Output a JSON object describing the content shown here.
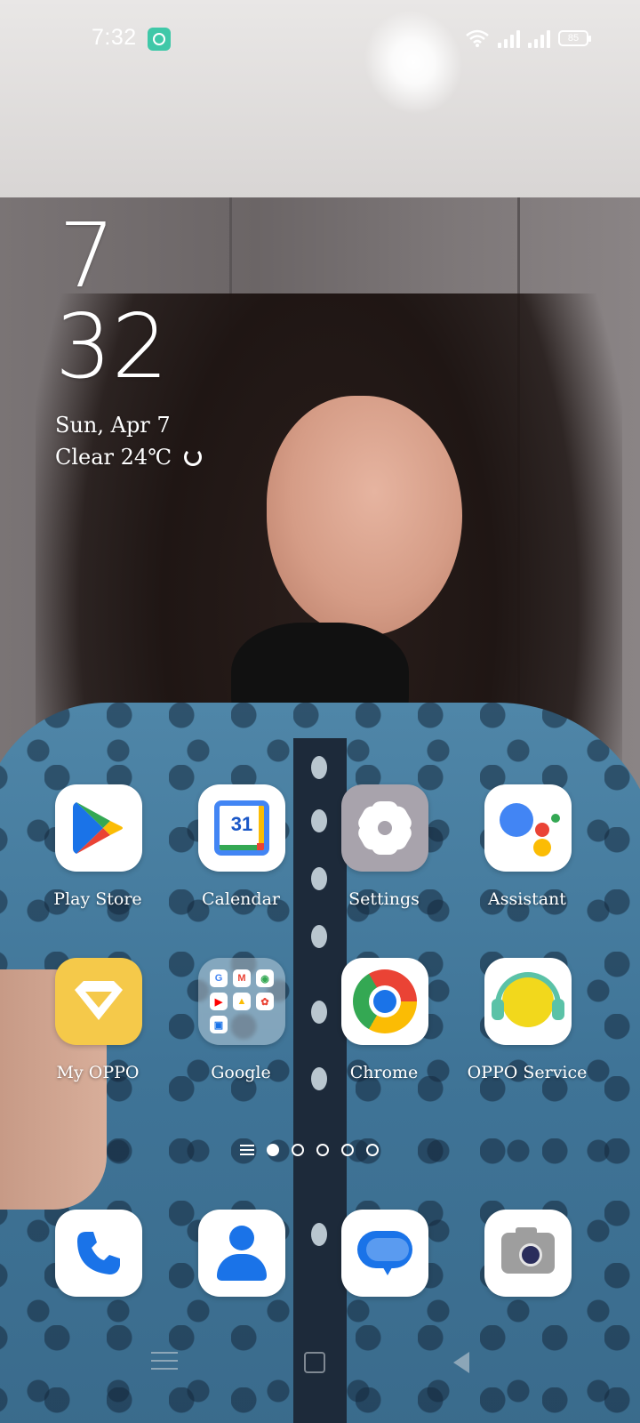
{
  "status_bar": {
    "time": "7:32",
    "battery": "85",
    "icons": [
      "notification-app-icon",
      "wifi-icon",
      "signal-icon",
      "signal-icon",
      "battery-icon"
    ]
  },
  "clock_widget": {
    "hour": "7",
    "minute": "32",
    "date": "Sun, Apr 7",
    "weather": "Clear 24℃"
  },
  "apps": {
    "row1": [
      {
        "label": "Play Store",
        "icon": "play-store-icon"
      },
      {
        "label": "Calendar",
        "icon": "calendar-icon",
        "badge": "31"
      },
      {
        "label": "Settings",
        "icon": "settings-gear-icon"
      },
      {
        "label": "Assistant",
        "icon": "google-assistant-icon"
      }
    ],
    "row2": [
      {
        "label": "My OPPO",
        "icon": "my-oppo-diamond-icon"
      },
      {
        "label": "Google",
        "icon": "google-folder-icon",
        "folder_items": [
          "G",
          "M",
          "◉",
          "▶",
          "▲",
          "✿",
          "▣"
        ]
      },
      {
        "label": "Chrome",
        "icon": "chrome-icon"
      },
      {
        "label": "OPPO Service",
        "icon": "headset-icon"
      }
    ]
  },
  "dock": [
    {
      "icon": "phone-icon",
      "glyph": "✆"
    },
    {
      "icon": "contacts-icon"
    },
    {
      "icon": "messages-icon"
    },
    {
      "icon": "camera-icon"
    }
  ],
  "page_indicator": {
    "pages": 5,
    "active": 1
  },
  "navigation": [
    "menu-icon",
    "home-icon",
    "back-icon"
  ]
}
